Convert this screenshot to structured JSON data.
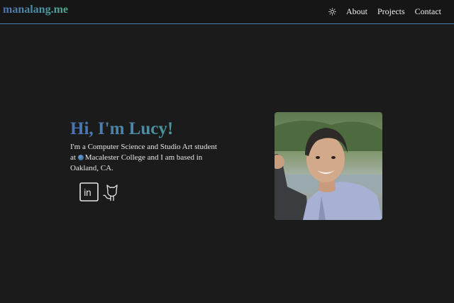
{
  "nav": {
    "brand": "manalang.me",
    "theme_toggle_icon": "sun-icon",
    "links": [
      "About",
      "Projects",
      "Contact"
    ]
  },
  "hero": {
    "greeting": "Hi, I'm Lucy!",
    "bio_before": "I'm a Computer Science and Studio Art student at ",
    "college": "Macalester College",
    "bio_after": " and I am based in Oakland, CA.",
    "college_icon": "globe-icon",
    "social_icons": [
      "linkedin-icon",
      "github-icon"
    ],
    "photo_alt": "Portrait photo"
  },
  "colors": {
    "background": "#1b1b1b",
    "navbar": "#161616",
    "divider": "#4f7ea3",
    "gradient_start": "#4a73b5",
    "gradient_end": "#4fa88e"
  }
}
